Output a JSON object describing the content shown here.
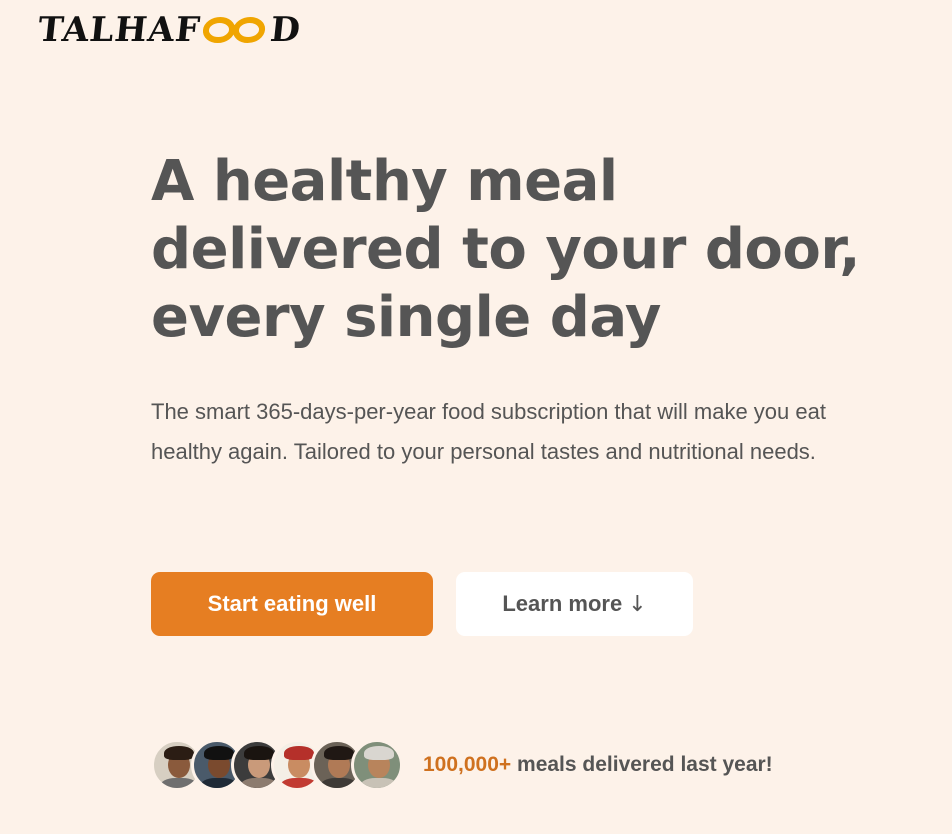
{
  "brand": {
    "logo_start": "TALHAF",
    "logo_end": "D",
    "logo_accent_color": "#f0a500"
  },
  "hero": {
    "title": "A healthy meal delivered to your door, every single day",
    "description": "The smart 365-days-per-year food subscription that will make you eat healthy again. Tailored to your personal tastes and nutritional needs.",
    "primary_button": "Start eating well",
    "secondary_button": "Learn more",
    "secondary_arrow": "↓"
  },
  "delivered": {
    "count": "100,000+",
    "text": " meals delivered last year!",
    "avatars": [
      "customer-1",
      "customer-2",
      "customer-3",
      "customer-4",
      "customer-5",
      "customer-6"
    ]
  },
  "colors": {
    "background": "#fdf2e9",
    "primary": "#e67e22",
    "text": "#555555",
    "accent_text": "#cf711f"
  }
}
